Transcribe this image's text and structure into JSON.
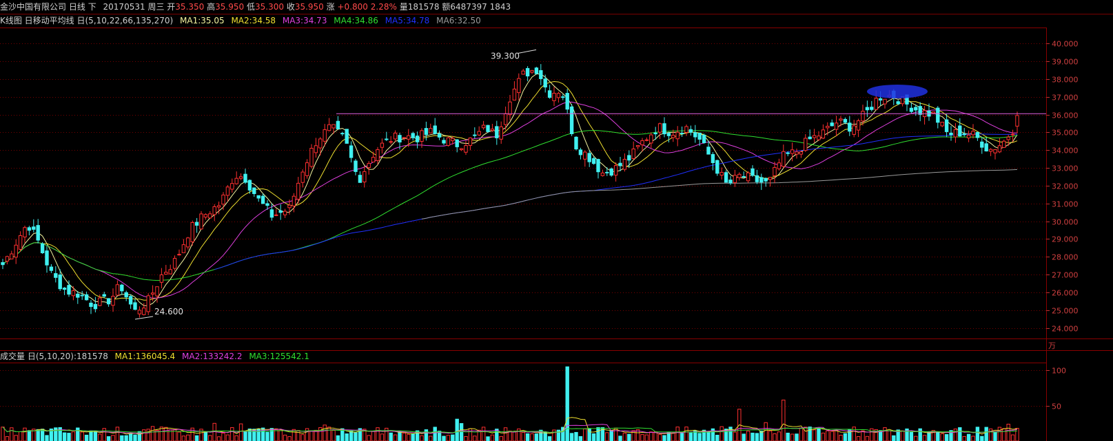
{
  "header": {
    "stock_name": "金沙中国有限公司",
    "period": "日线",
    "mode": "下",
    "date": "20170531",
    "weekday": "周三",
    "open_label": "开",
    "open_value": "35.350",
    "high_label": "高",
    "high_value": "35.950",
    "low_label": "低",
    "low_value": "35.300",
    "close_label": "收",
    "close_value": "35.950",
    "change_label": "涨",
    "change_value": "+0.800",
    "change_pct": "2.28%",
    "volume_label": "量",
    "volume_value": "181578",
    "amount_label": "额",
    "amount_value": "6487397",
    "extra": "1843"
  },
  "ma_legend": {
    "title": "K线图 日移动平均线 日(5,10,22,66,135,270)",
    "items": [
      {
        "text": "MA1:35.05",
        "color": "#f5f5a0"
      },
      {
        "text": "MA2:34.58",
        "color": "#f0e030"
      },
      {
        "text": "MA3:34.73",
        "color": "#e040e0"
      },
      {
        "text": "MA4:34.86",
        "color": "#30e030"
      },
      {
        "text": "MA5:34.78",
        "color": "#2030ff"
      },
      {
        "text": "MA6:32.50",
        "color": "#9a9a9a"
      }
    ]
  },
  "volume_legend": {
    "title": "成交量 日(5,10,20)",
    "value": ":181578",
    "items": [
      {
        "text": "MA1:136045.4",
        "color": "#f0e030"
      },
      {
        "text": "MA2:133242.2",
        "color": "#e040e0"
      },
      {
        "text": "MA3:125542.1",
        "color": "#30e030"
      }
    ]
  },
  "chart_data": [
    {
      "type": "candlestick",
      "y_ticks": [
        "24.000",
        "25.000",
        "26.000",
        "27.000",
        "28.000",
        "29.000",
        "30.000",
        "31.000",
        "32.000",
        "33.000",
        "34.000",
        "35.000",
        "36.000",
        "37.000",
        "38.000",
        "39.000",
        "40.000"
      ],
      "ylim": [
        23.4,
        40.9
      ],
      "grid": true,
      "annotations": [
        {
          "text": "39.300",
          "value": 39.3
        },
        {
          "text": "24.600",
          "value": 24.6
        }
      ],
      "resistance_level": 36.05,
      "last_candle": {
        "open": 35.35,
        "high": 35.95,
        "low": 35.3,
        "close": 35.95
      },
      "colors": {
        "up": "#ff3030",
        "down": "#40f0f0"
      },
      "series": [
        {
          "name": "MA1",
          "color": "#f5f5a0"
        },
        {
          "name": "MA2",
          "color": "#f0e030"
        },
        {
          "name": "MA3",
          "color": "#e040e0"
        },
        {
          "name": "MA4",
          "color": "#30e030"
        },
        {
          "name": "MA5",
          "color": "#2030ff"
        },
        {
          "name": "MA6",
          "color": "#9a9a9a"
        }
      ],
      "close_keypoints": [
        [
          0,
          27.3
        ],
        [
          20,
          28.6
        ],
        [
          40,
          29.9
        ],
        [
          55,
          28.9
        ],
        [
          75,
          27.0
        ],
        [
          95,
          26.1
        ],
        [
          115,
          25.9
        ],
        [
          135,
          25.3
        ],
        [
          160,
          25.6
        ],
        [
          175,
          26.4
        ],
        [
          195,
          24.9
        ],
        [
          215,
          25.5
        ],
        [
          235,
          27.0
        ],
        [
          255,
          27.8
        ],
        [
          275,
          29.5
        ],
        [
          295,
          30.3
        ],
        [
          320,
          31.0
        ],
        [
          340,
          32.6
        ],
        [
          355,
          32.5
        ],
        [
          375,
          31.2
        ],
        [
          395,
          30.3
        ],
        [
          420,
          30.7
        ],
        [
          440,
          33.0
        ],
        [
          460,
          34.6
        ],
        [
          480,
          35.3
        ],
        [
          500,
          34.6
        ],
        [
          520,
          32.3
        ],
        [
          545,
          34.0
        ],
        [
          565,
          34.6
        ],
        [
          585,
          34.8
        ],
        [
          605,
          34.7
        ],
        [
          625,
          35.0
        ],
        [
          645,
          34.6
        ],
        [
          665,
          34.3
        ],
        [
          685,
          34.6
        ],
        [
          705,
          35.3
        ],
        [
          720,
          34.8
        ],
        [
          740,
          37.0
        ],
        [
          760,
          38.3
        ],
        [
          780,
          38.6
        ],
        [
          795,
          37.2
        ],
        [
          815,
          37.4
        ],
        [
          835,
          34.3
        ],
        [
          855,
          33.6
        ],
        [
          875,
          32.7
        ],
        [
          895,
          33.0
        ],
        [
          915,
          33.6
        ],
        [
          935,
          34.6
        ],
        [
          955,
          35.3
        ],
        [
          975,
          35.0
        ],
        [
          995,
          35.3
        ],
        [
          1015,
          34.6
        ],
        [
          1035,
          33.3
        ],
        [
          1055,
          32.0
        ],
        [
          1075,
          32.6
        ],
        [
          1095,
          32.3
        ],
        [
          1115,
          32.1
        ],
        [
          1135,
          33.6
        ],
        [
          1155,
          33.9
        ],
        [
          1175,
          34.6
        ],
        [
          1195,
          35.0
        ],
        [
          1215,
          35.6
        ],
        [
          1235,
          35.3
        ],
        [
          1255,
          36.0
        ],
        [
          1275,
          37.0
        ],
        [
          1295,
          37.1
        ],
        [
          1315,
          36.6
        ],
        [
          1335,
          36.2
        ],
        [
          1355,
          36.0
        ],
        [
          1375,
          34.9
        ],
        [
          1395,
          35.0
        ],
        [
          1415,
          34.8
        ],
        [
          1435,
          34.0
        ],
        [
          1455,
          34.4
        ],
        [
          1470,
          35.2
        ],
        [
          1480,
          35.95
        ]
      ]
    },
    {
      "type": "bar",
      "y_ticks": [
        "50",
        "100"
      ],
      "unit": "万",
      "ylim": [
        0,
        110
      ],
      "peaks": [
        {
          "x_index": 825,
          "value": 105
        },
        {
          "x_index": 1135,
          "value": 58
        },
        {
          "x_index": 1072,
          "value": 45
        }
      ],
      "series": [
        {
          "name": "MA1",
          "color": "#f0e030"
        },
        {
          "name": "MA2",
          "color": "#e040e0"
        },
        {
          "name": "MA3",
          "color": "#30e030"
        }
      ]
    }
  ]
}
